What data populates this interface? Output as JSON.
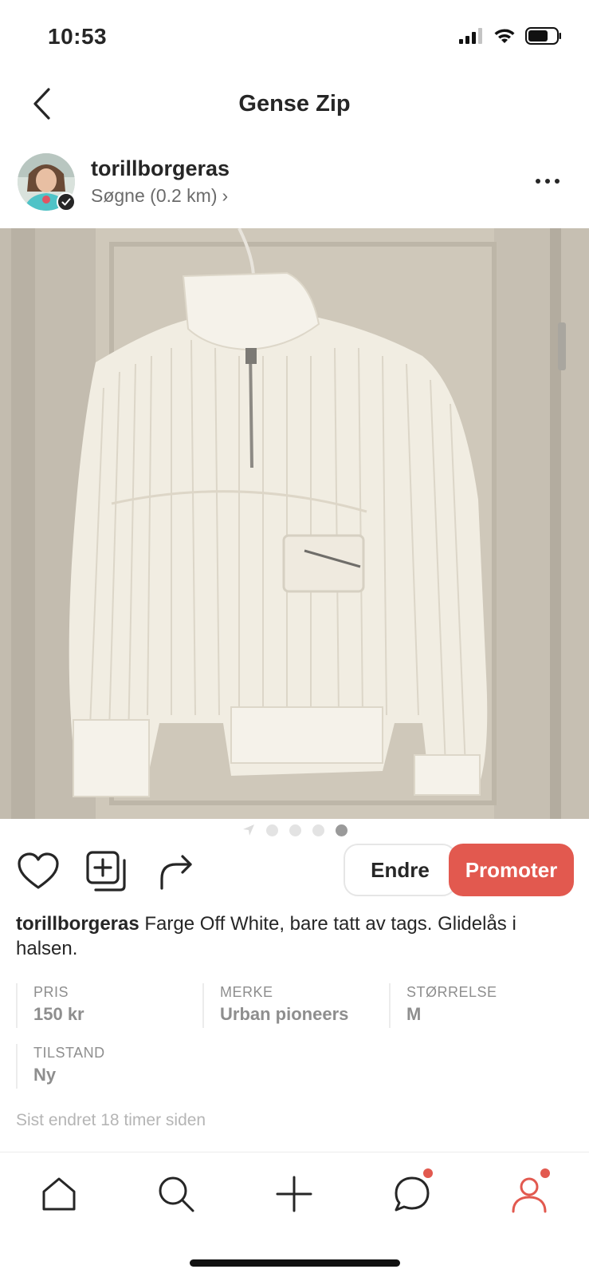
{
  "status_bar": {
    "time": "10:53"
  },
  "header": {
    "title": "Gense Zip"
  },
  "seller": {
    "username": "torillborgeras",
    "location": "Søgne (0.2 km)",
    "location_arrow": "›"
  },
  "listing": {
    "photo_alt": "Off-white ribbed half-zip sweater on hanger",
    "carousel": {
      "count": 4,
      "active_index": 3
    },
    "actions": {
      "edit_label": "Endre",
      "promote_label": "Promoter"
    },
    "description": {
      "username": "torillborgeras",
      "text": "Farge Off White, bare tatt av tags. Glidelås i halsen."
    },
    "attributes": [
      {
        "label": "PRIS",
        "value": "150 kr"
      },
      {
        "label": "MERKE",
        "value": "Urban pioneers"
      },
      {
        "label": "STØRRELSE",
        "value": "M"
      },
      {
        "label": "TILSTAND",
        "value": "Ny"
      }
    ],
    "last_edited": "Sist endret 18 timer siden"
  },
  "tabbar": {
    "tabs": [
      {
        "icon": "home-icon",
        "badge": false
      },
      {
        "icon": "search-icon",
        "badge": false
      },
      {
        "icon": "plus-icon",
        "badge": false
      },
      {
        "icon": "chat-icon",
        "badge": true
      },
      {
        "icon": "profile-icon",
        "badge": true,
        "active": true
      }
    ]
  },
  "colors": {
    "accent": "#e2594f",
    "text": "#262626",
    "muted": "#8e8e8e"
  }
}
